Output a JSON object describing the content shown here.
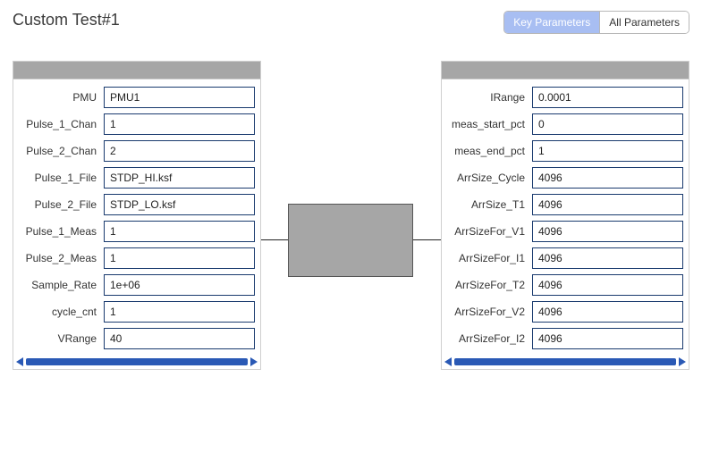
{
  "title": "Custom Test#1",
  "tabs": {
    "key": "Key Parameters",
    "all": "All Parameters"
  },
  "leftPanel": {
    "rows": [
      {
        "label": "PMU",
        "value": "PMU1"
      },
      {
        "label": "Pulse_1_Chan",
        "value": "1"
      },
      {
        "label": "Pulse_2_Chan",
        "value": "2"
      },
      {
        "label": "Pulse_1_File",
        "value": "STDP_HI.ksf"
      },
      {
        "label": "Pulse_2_File",
        "value": "STDP_LO.ksf"
      },
      {
        "label": "Pulse_1_Meas",
        "value": "1"
      },
      {
        "label": "Pulse_2_Meas",
        "value": "1"
      },
      {
        "label": "Sample_Rate",
        "value": "1e+06"
      },
      {
        "label": "cycle_cnt",
        "value": "1"
      },
      {
        "label": "VRange",
        "value": "40"
      }
    ]
  },
  "rightPanel": {
    "rows": [
      {
        "label": "IRange",
        "value": "0.0001"
      },
      {
        "label": "meas_start_pct",
        "value": "0"
      },
      {
        "label": "meas_end_pct",
        "value": "1"
      },
      {
        "label": "ArrSize_Cycle",
        "value": "4096"
      },
      {
        "label": "ArrSize_T1",
        "value": "4096"
      },
      {
        "label": "ArrSizeFor_V1",
        "value": "4096"
      },
      {
        "label": "ArrSizeFor_I1",
        "value": "4096"
      },
      {
        "label": "ArrSizeFor_T2",
        "value": "4096"
      },
      {
        "label": "ArrSizeFor_V2",
        "value": "4096"
      },
      {
        "label": "ArrSizeFor_I2",
        "value": "4096"
      }
    ]
  }
}
